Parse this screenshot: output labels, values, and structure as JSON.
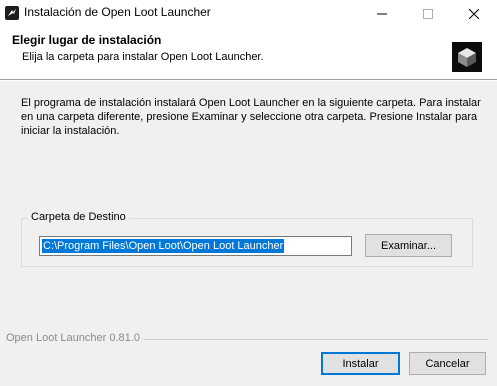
{
  "window": {
    "title": "Instalación de Open Loot Launcher",
    "icon": "app-logo-icon"
  },
  "titlebar_controls": {
    "minimize_icon": "minimize-icon",
    "maximize_icon": "maximize-icon",
    "close_icon": "close-icon"
  },
  "header": {
    "title": "Elegir lugar de instalación",
    "subtitle": "Elija la carpeta para instalar Open Loot Launcher.",
    "logo_icon": "open-loot-logo-icon"
  },
  "body": {
    "info": "El programa de instalación instalará Open Loot Launcher en la siguiente carpeta. Para instalar en una carpeta diferente, presione Examinar y seleccione otra carpeta. Presione Instalar para iniciar la instalación."
  },
  "destination": {
    "group_label": "Carpeta de Destino",
    "path_value": "C:\\Program Files\\Open Loot\\Open Loot Launcher",
    "browse_label": "Examinar..."
  },
  "footer": {
    "branding": "Open Loot Launcher 0.81.0",
    "install_label": "Instalar",
    "cancel_label": "Cancelar"
  },
  "colors": {
    "selection": "#0078d7",
    "window_bg": "#f0f0f0",
    "header_bg": "#ffffff"
  }
}
